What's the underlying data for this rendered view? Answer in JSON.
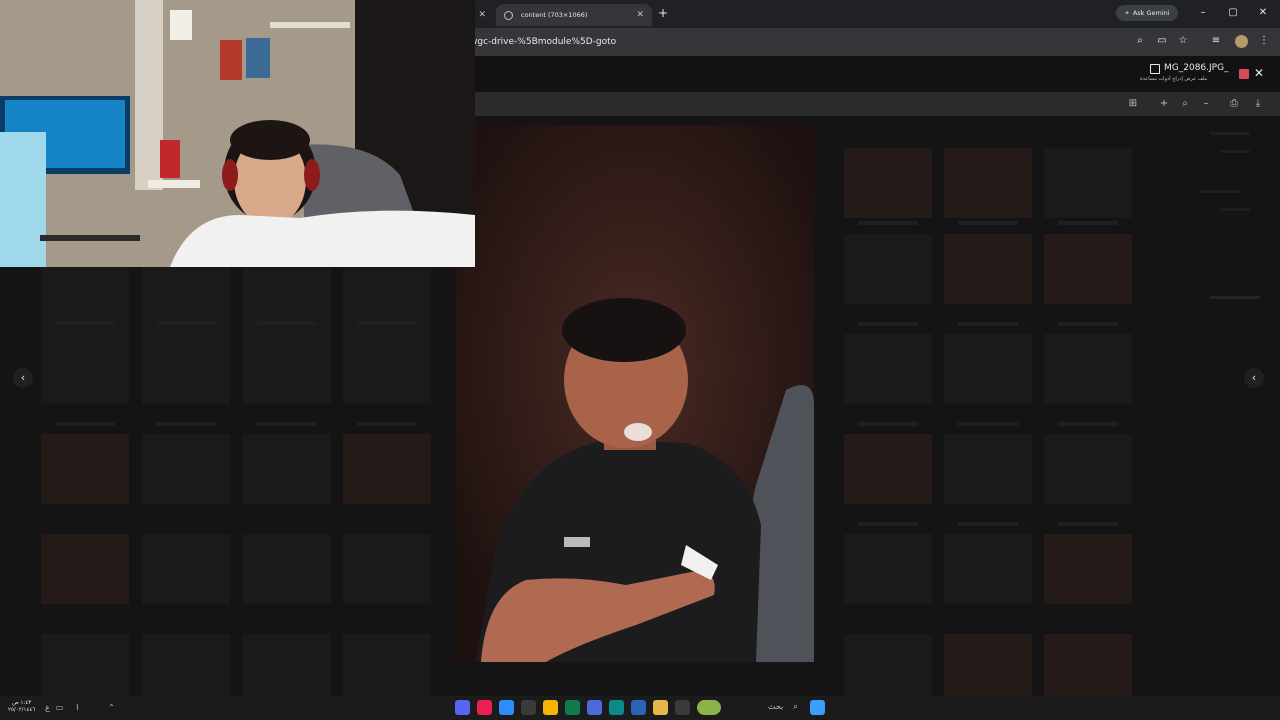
{
  "browser": {
    "tabs": [
      {
        "label": "content (703×1066)"
      }
    ],
    "new_tab_symbol": "+",
    "gemini_button": "Ask Gemini",
    "url": "wgc-drive-%5Bmodule%5D-goto",
    "window_controls": [
      "–",
      "▢",
      "✕"
    ]
  },
  "viewer": {
    "filename": "MG_2086.JPG_",
    "close_symbol": "✕",
    "subline": "ملف  عرض  إدراج  أدوات  مساعدة",
    "prev_symbol": "‹",
    "next_symbol": "‹"
  },
  "taskbar": {
    "clock_time": "١:٤٣ ص",
    "clock_date": "٢٥/٠٢/١٤٤٦",
    "search_label": "بحث"
  },
  "colors": {
    "chrome_dark": "#202124",
    "toolbar": "#35363a",
    "accent_red": "#d94b59",
    "background": "#0e0e0e"
  },
  "icons": [
    "search-icon",
    "cast-icon",
    "star-icon",
    "media-icon",
    "profile-avatar",
    "menu-icon",
    "print-icon",
    "download-icon",
    "zoom-in-icon",
    "zoom-out-icon"
  ]
}
